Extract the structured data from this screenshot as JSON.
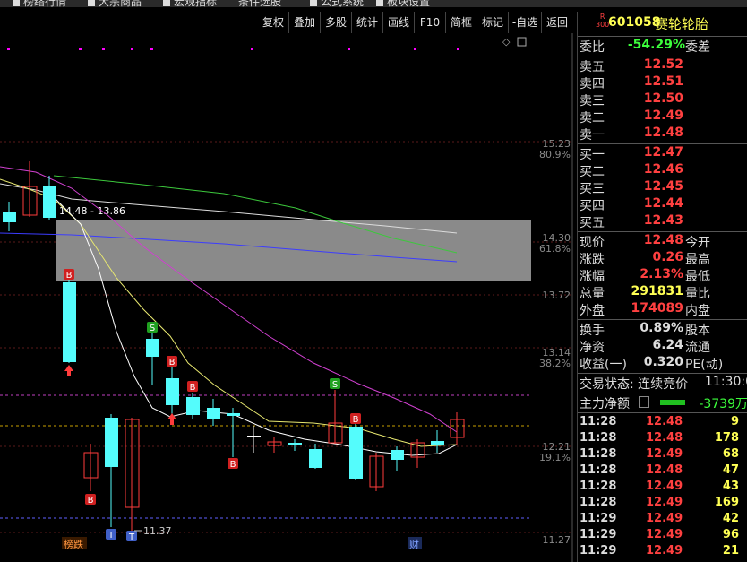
{
  "menubar": {
    "items": [
      "榜络行情",
      "大宗商品",
      "宏观指标",
      "条件选股",
      "公式系统",
      "板块设置"
    ]
  },
  "toolbar": {
    "buttons": [
      "复权",
      "叠加",
      "多股",
      "统计",
      "画线",
      "F10",
      "简框",
      "标记",
      "-自选",
      "返回"
    ]
  },
  "chart": {
    "price_labels": [
      "15.23",
      "14.30",
      "13.72",
      "13.14",
      "12.21",
      "11.27"
    ],
    "pct_labels": [
      "80.9%",
      "61.8%",
      "38.2%",
      "19.1%"
    ],
    "range_label": "14.48 - 13.86",
    "low_label": "11.37",
    "marker_b": "B",
    "marker_s": "S",
    "marker_t": "T",
    "tag_bangdie": "榜跌",
    "tag_cai": "财",
    "colors": {
      "up": "#ff3c3c",
      "down": "#54fcfc",
      "ma1": "#ffffff",
      "ma2": "#ffff54",
      "ma3": "#ff54ff",
      "ma4": "#54ff54",
      "ma5": "#5454ff"
    }
  },
  "quote": {
    "badge_top": "R",
    "badge_bottom": "300",
    "code": "601058",
    "name": "赛轮轮胎",
    "weibi_label": "委比",
    "weibi_value": "-54.29%",
    "weicha_label": "委差",
    "asks": [
      {
        "label": "卖五",
        "price": "12.52"
      },
      {
        "label": "卖四",
        "price": "12.51"
      },
      {
        "label": "卖三",
        "price": "12.50"
      },
      {
        "label": "卖二",
        "price": "12.49"
      },
      {
        "label": "卖一",
        "price": "12.48"
      }
    ],
    "bids": [
      {
        "label": "买一",
        "price": "12.47"
      },
      {
        "label": "买二",
        "price": "12.46"
      },
      {
        "label": "买三",
        "price": "12.45"
      },
      {
        "label": "买四",
        "price": "12.44"
      },
      {
        "label": "买五",
        "price": "12.43"
      }
    ],
    "stats": [
      {
        "label": "现价",
        "value": "12.48",
        "label2": "今开"
      },
      {
        "label": "涨跌",
        "value": "0.26",
        "label2": "最高"
      },
      {
        "label": "涨幅",
        "value": "2.13%",
        "label2": "最低"
      },
      {
        "label": "总量",
        "value": "291831",
        "label2": "量比"
      },
      {
        "label": "外盘",
        "value": "174089",
        "label2": "内盘"
      }
    ],
    "stats2": [
      {
        "label": "换手",
        "value": "0.89%",
        "label2": "股本"
      },
      {
        "label": "净资",
        "value": "6.24",
        "label2": "流通"
      },
      {
        "label": "收益(一)",
        "value": "0.320",
        "label2": "PE(动)"
      }
    ],
    "trade_status": "交易状态: 连续竞价",
    "trade_time": "11:30:0",
    "main_net_label": "主力净额",
    "main_net_value": "-3739万",
    "ticks": [
      {
        "time": "11:28",
        "price": "12.48",
        "vol": "9"
      },
      {
        "time": "11:28",
        "price": "12.48",
        "vol": "178"
      },
      {
        "time": "11:28",
        "price": "12.49",
        "vol": "68"
      },
      {
        "time": "11:28",
        "price": "12.48",
        "vol": "47"
      },
      {
        "time": "11:28",
        "price": "12.49",
        "vol": "43"
      },
      {
        "time": "11:28",
        "price": "12.49",
        "vol": "169"
      },
      {
        "time": "11:29",
        "price": "12.49",
        "vol": "42"
      },
      {
        "time": "11:29",
        "price": "12.49",
        "vol": "96"
      },
      {
        "time": "11:29",
        "price": "12.49",
        "vol": "21"
      }
    ]
  }
}
